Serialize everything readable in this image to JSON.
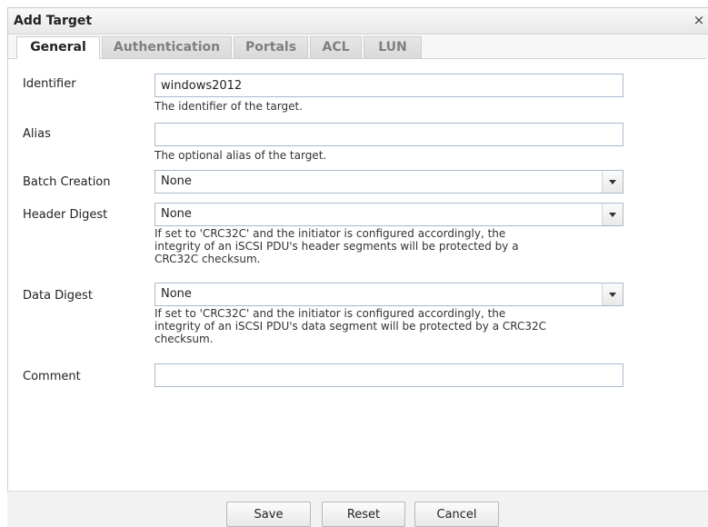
{
  "dialog": {
    "title": "Add Target",
    "close_label": "×"
  },
  "tabs": [
    {
      "label": "General",
      "active": true
    },
    {
      "label": "Authentication",
      "active": false
    },
    {
      "label": "Portals",
      "active": false
    },
    {
      "label": "ACL",
      "active": false
    },
    {
      "label": "LUN",
      "active": false
    }
  ],
  "form": {
    "identifier": {
      "label": "Identifier",
      "value": "windows2012",
      "help": "The identifier of the target."
    },
    "alias": {
      "label": "Alias",
      "value": "",
      "help": "The optional alias of the target."
    },
    "batch_creation": {
      "label": "Batch Creation",
      "value": "None"
    },
    "header_digest": {
      "label": "Header Digest",
      "value": "None",
      "help_lines": [
        "If set to 'CRC32C' and the initiator is configured accordingly, the",
        "integrity of an iSCSI PDU's header segments will be protected by a",
        "CRC32C checksum."
      ]
    },
    "data_digest": {
      "label": "Data Digest",
      "value": "None",
      "help_lines": [
        "If set to 'CRC32C' and the initiator is configured accordingly, the",
        "integrity of an iSCSI PDU's data segment will be protected by a CRC32C",
        "checksum."
      ]
    },
    "comment": {
      "label": "Comment",
      "value": ""
    }
  },
  "footer": {
    "save_label": "Save",
    "reset_label": "Reset",
    "cancel_label": "Cancel"
  }
}
